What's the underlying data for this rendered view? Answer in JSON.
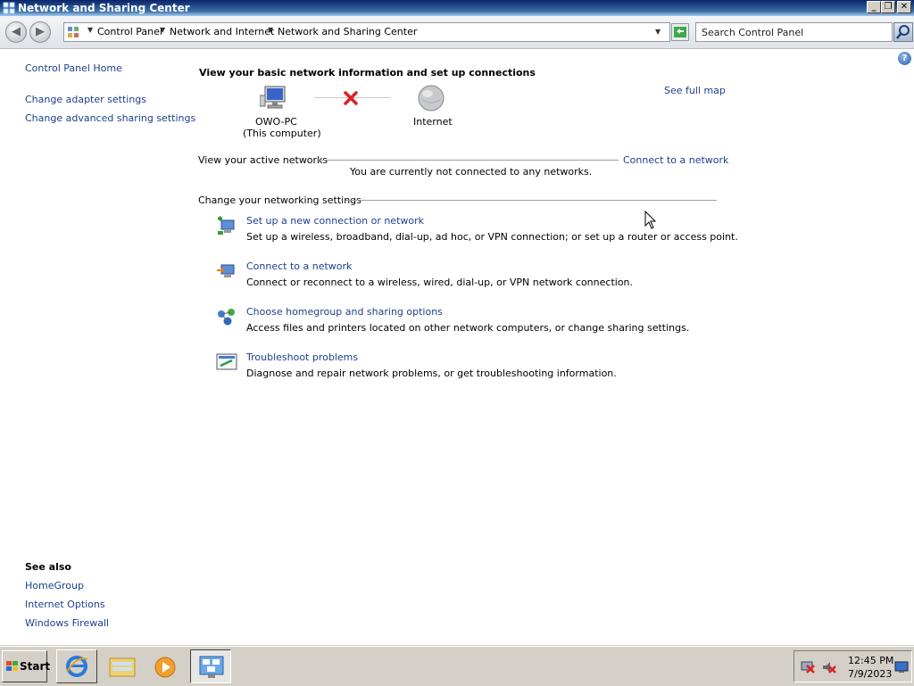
{
  "window": {
    "title": "Network and Sharing Center",
    "minimize": "_",
    "restore": "❐",
    "close": "✕"
  },
  "address_bar": {
    "crumbs": [
      "Control Panel",
      "Network and Internet",
      "Network and Sharing Center"
    ],
    "search_placeholder": "Search Control Panel"
  },
  "sidebar": {
    "home": "Control Panel Home",
    "links": [
      "Change adapter settings",
      "Change advanced sharing settings"
    ],
    "see_also_title": "See also",
    "see_also": [
      "HomeGroup",
      "Internet Options",
      "Windows Firewall"
    ]
  },
  "main": {
    "heading": "View your basic network information and set up connections",
    "see_full_map": "See full map",
    "computer_name": "OWO-PC",
    "computer_sub": "(This computer)",
    "internet_label": "Internet",
    "active_networks_label": "View your active networks",
    "connect_link": "Connect to a network",
    "not_connected": "You are currently not connected to any networks.",
    "settings_label": "Change your networking settings",
    "tasks": [
      {
        "title": "Set up a new connection or network",
        "desc": "Set up a wireless, broadband, dial-up, ad hoc, or VPN connection; or set up a router or access point."
      },
      {
        "title": "Connect to a network",
        "desc": "Connect or reconnect to a wireless, wired, dial-up, or VPN network connection."
      },
      {
        "title": "Choose homegroup and sharing options",
        "desc": "Access files and printers located on other network computers, or change sharing settings."
      },
      {
        "title": "Troubleshoot problems",
        "desc": "Diagnose and repair network problems, or get troubleshooting information."
      }
    ]
  },
  "taskbar": {
    "start_label": "Start",
    "time": "12:45 PM",
    "date": "7/9/2023"
  },
  "colors": {
    "link": "#1d3f8f",
    "title_gradient_start": "#0a246a"
  }
}
